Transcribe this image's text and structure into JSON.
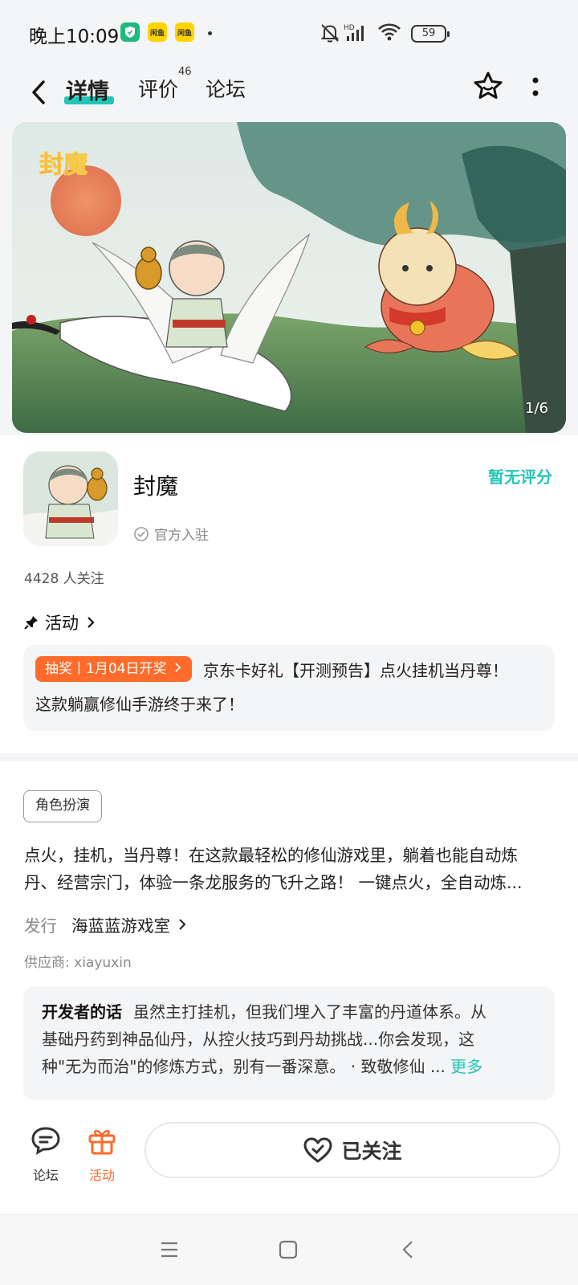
{
  "status_bar": {
    "time": "晚上10:09",
    "app_icons": [
      "shield-app-icon",
      "yellow-app-icon",
      "yellow-app-icon"
    ],
    "app_labels": [
      "",
      "闲鱼",
      "闲鱼"
    ],
    "network": "HD",
    "battery": "59"
  },
  "header": {
    "tabs": [
      {
        "label": "详情",
        "active": true
      },
      {
        "label": "评价",
        "badge": "46"
      },
      {
        "label": "论坛"
      }
    ]
  },
  "banner": {
    "logo_text": "封魔",
    "counter": "1/6"
  },
  "game": {
    "name": "封魔",
    "official_label": "官方入驻",
    "rating": "暂无评分",
    "followers": "4428 人关注"
  },
  "activity": {
    "title": "活动",
    "badge": "抽奖丨1月04日开奖",
    "text_line1": "京东卡好礼【开测预告】点火挂机当丹尊！",
    "text_line2": "这款躺赢修仙手游终于来了！"
  },
  "details": {
    "tag": "角色扮演",
    "description_line1": "点火，挂机，当丹尊！在这款最轻松的修仙游戏里，躺着也能自动炼",
    "description_line2": "丹、经营宗门，体验一条龙服务的飞升之路！ 一键点火，全自动炼...",
    "publisher_label": "发行",
    "publisher": "海蓝蓝游戏室",
    "supplier": "供应商: xiayuxin"
  },
  "developer_note": {
    "title": "开发者的话",
    "line1": "虽然主打挂机，但我们埋入了丰富的丹道体系。从",
    "line2": "基础丹药到神品仙丹，从控火技巧到丹劫挑战...你会发现，这",
    "line3": "种\"无为而治\"的修炼方式，别有一番深意。 · 致敬修仙 ...",
    "more": "更多"
  },
  "bottom_bar": {
    "forum_label": "论坛",
    "activity_label": "活动",
    "follow_label": "已关注"
  },
  "colors": {
    "accent": "#22c6b8",
    "orange": "#ff6b2b",
    "background": "#f4f5f7"
  }
}
